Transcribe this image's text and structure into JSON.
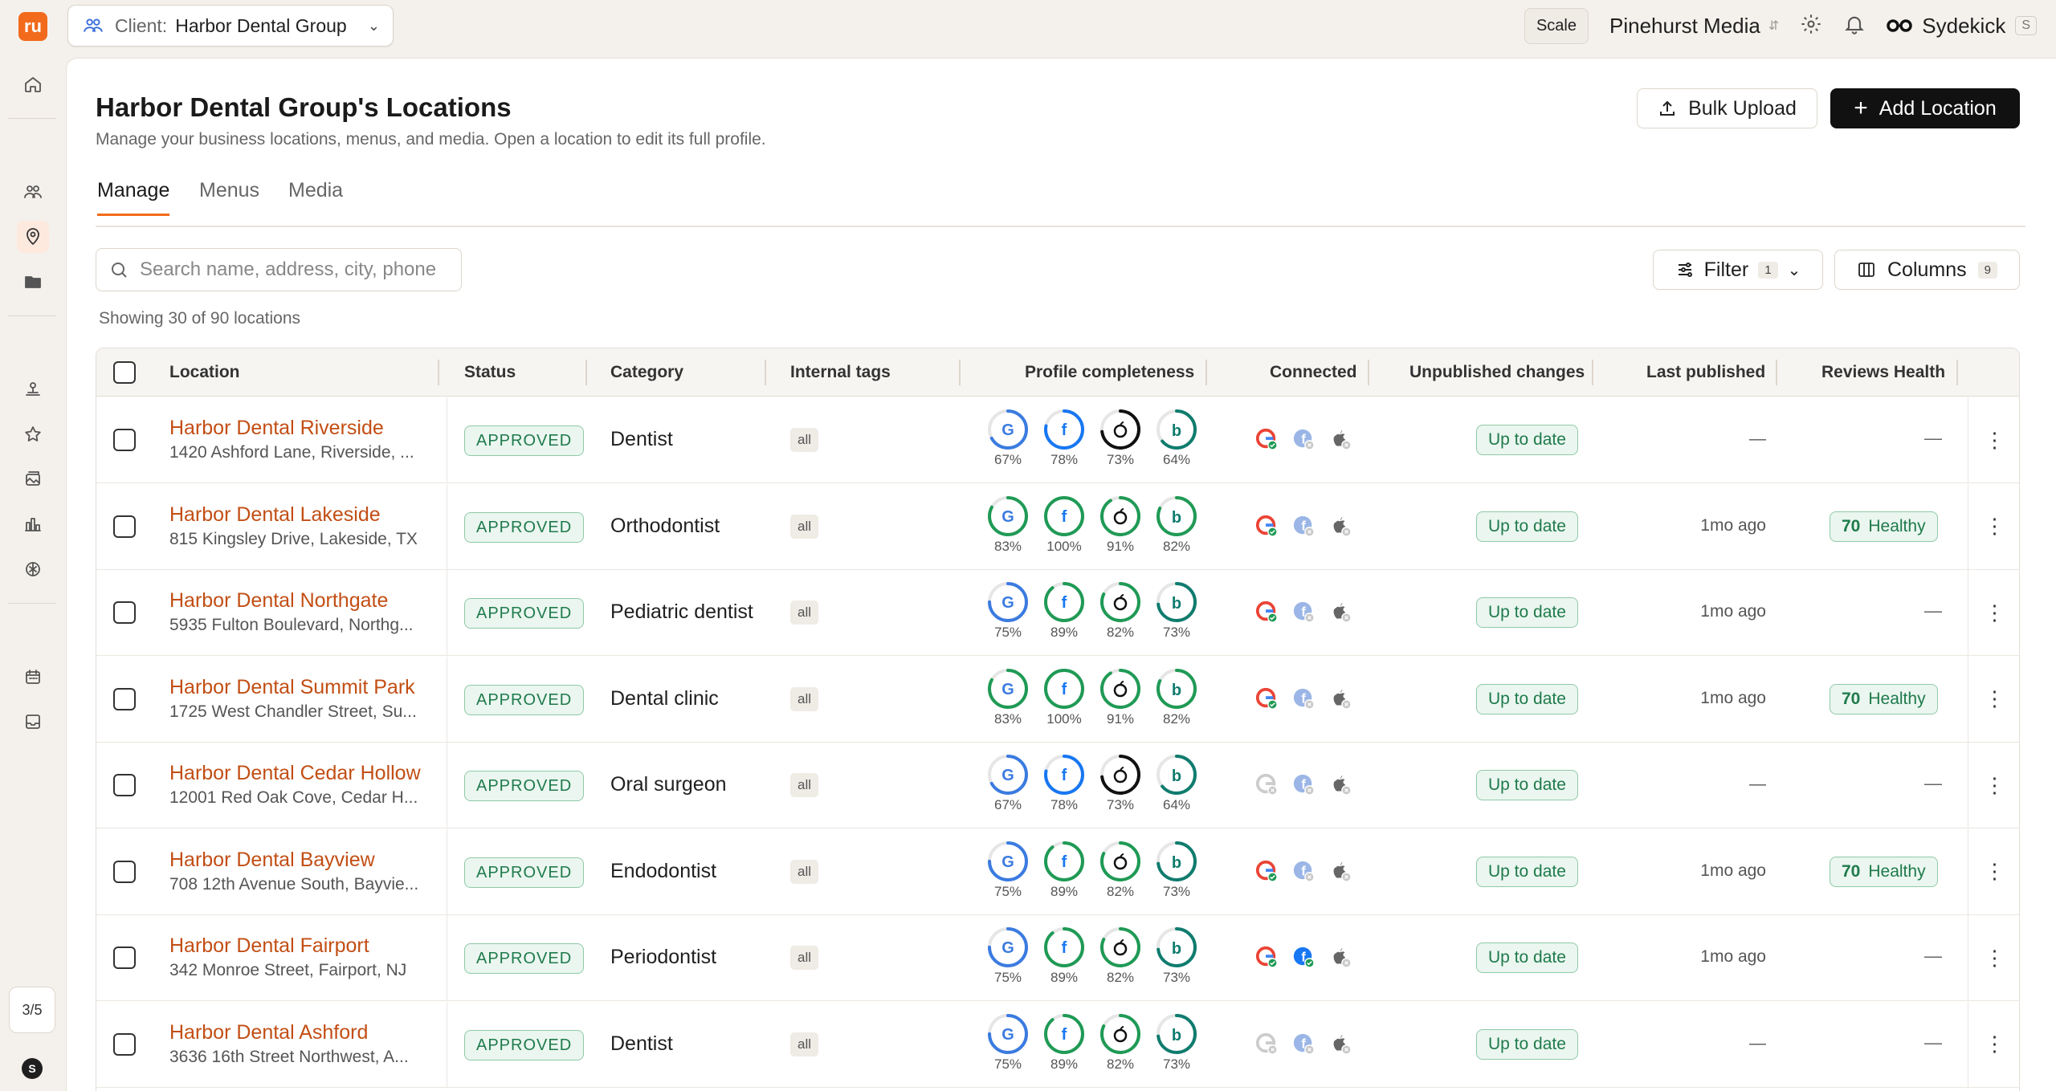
{
  "rail": {
    "logo": "ru",
    "pager": "3/5",
    "avatar": "S"
  },
  "topbar": {
    "client_label": "Client:",
    "client_value": "Harbor Dental Group",
    "scale": "Scale",
    "org": "Pinehurst Media",
    "sydekick": "Sydekick",
    "sydekick_kbd": "S"
  },
  "page": {
    "title": "Harbor Dental Group's Locations",
    "subtitle": "Manage your business locations, menus, and media. Open a location to edit its full profile.",
    "bulk_upload": "Bulk Upload",
    "add_location": "Add Location"
  },
  "tabs": [
    {
      "label": "Manage"
    },
    {
      "label": "Menus"
    },
    {
      "label": "Media"
    }
  ],
  "search": {
    "placeholder": "Search name, address, city, phone"
  },
  "filter": {
    "label": "Filter",
    "count": "1"
  },
  "columns": {
    "label": "Columns",
    "count": "9"
  },
  "showing": "Showing 30 of 90 locations",
  "headers": {
    "location": "Location",
    "status": "Status",
    "category": "Category",
    "tags": "Internal tags",
    "profile": "Profile completeness",
    "connected": "Connected",
    "unpublished": "Unpublished changes",
    "last_published": "Last published",
    "reviews": "Reviews Health"
  },
  "colors": {
    "accent": "#f26a1b",
    "google": "#3b7be0",
    "facebook": "#1877f2",
    "apple": "#111111",
    "bing": "#0f7c6e",
    "ring_green": "#1f9a55"
  },
  "rows": [
    {
      "name": "Harbor Dental Riverside",
      "address": "1420 Ashford Lane, Riverside, ...",
      "status": "APPROVED",
      "category": "Dentist",
      "tag": "all",
      "g": 67,
      "f": 78,
      "a": 73,
      "b": 64,
      "gc": true,
      "fc": false,
      "ac": false,
      "changes": "Up to date",
      "published": "—",
      "health_score": "",
      "health_label": "",
      "reviews": "—"
    },
    {
      "name": "Harbor Dental Lakeside",
      "address": "815 Kingsley Drive, Lakeside, TX",
      "status": "APPROVED",
      "category": "Orthodontist",
      "tag": "all",
      "g": 83,
      "f": 100,
      "a": 91,
      "b": 82,
      "gc": true,
      "fc": false,
      "ac": false,
      "changes": "Up to date",
      "published": "1mo ago",
      "health_score": "70",
      "health_label": "Healthy",
      "reviews": ""
    },
    {
      "name": "Harbor Dental Northgate",
      "address": "5935 Fulton Boulevard, Northg...",
      "status": "APPROVED",
      "category": "Pediatric dentist",
      "tag": "all",
      "g": 75,
      "f": 89,
      "a": 82,
      "b": 73,
      "gc": true,
      "fc": false,
      "ac": false,
      "changes": "Up to date",
      "published": "1mo ago",
      "health_score": "",
      "health_label": "",
      "reviews": "—"
    },
    {
      "name": "Harbor Dental Summit Park",
      "address": "1725 West Chandler Street, Su...",
      "status": "APPROVED",
      "category": "Dental clinic",
      "tag": "all",
      "g": 83,
      "f": 100,
      "a": 91,
      "b": 82,
      "gc": true,
      "fc": false,
      "ac": false,
      "changes": "Up to date",
      "published": "1mo ago",
      "health_score": "70",
      "health_label": "Healthy",
      "reviews": ""
    },
    {
      "name": "Harbor Dental Cedar Hollow",
      "address": "12001 Red Oak Cove, Cedar H...",
      "status": "APPROVED",
      "category": "Oral surgeon",
      "tag": "all",
      "g": 67,
      "f": 78,
      "a": 73,
      "b": 64,
      "gc": false,
      "fc": false,
      "ac": false,
      "changes": "Up to date",
      "published": "—",
      "health_score": "",
      "health_label": "",
      "reviews": "—"
    },
    {
      "name": "Harbor Dental Bayview",
      "address": "708 12th Avenue South, Bayvie...",
      "status": "APPROVED",
      "category": "Endodontist",
      "tag": "all",
      "g": 75,
      "f": 89,
      "a": 82,
      "b": 73,
      "gc": true,
      "fc": false,
      "ac": false,
      "changes": "Up to date",
      "published": "1mo ago",
      "health_score": "70",
      "health_label": "Healthy",
      "reviews": ""
    },
    {
      "name": "Harbor Dental Fairport",
      "address": "342 Monroe Street, Fairport, NJ",
      "status": "APPROVED",
      "category": "Periodontist",
      "tag": "all",
      "g": 75,
      "f": 89,
      "a": 82,
      "b": 73,
      "gc": true,
      "fc": true,
      "ac": false,
      "changes": "Up to date",
      "published": "1mo ago",
      "health_score": "",
      "health_label": "",
      "reviews": "—"
    },
    {
      "name": "Harbor Dental Ashford",
      "address": "3636 16th Street Northwest, A...",
      "status": "APPROVED",
      "category": "Dentist",
      "tag": "all",
      "g": 75,
      "f": 89,
      "a": 82,
      "b": 73,
      "gc": false,
      "fc": false,
      "ac": false,
      "changes": "Up to date",
      "published": "—",
      "health_score": "",
      "health_label": "",
      "reviews": "—"
    }
  ]
}
